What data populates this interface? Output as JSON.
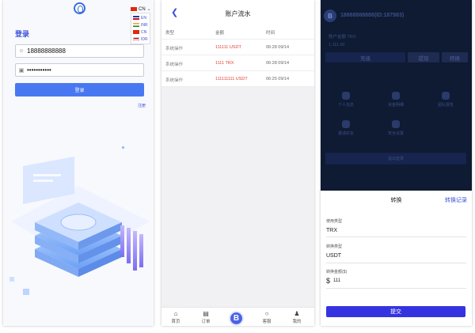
{
  "login": {
    "current_language": "CN",
    "languages": [
      "EN",
      "INR",
      "CN",
      "IDR"
    ],
    "title": "登录",
    "username_value": "18888888888",
    "password_value": "•••••••••••",
    "login_button": "登录",
    "register_link": "注册"
  },
  "flow": {
    "title": "账户流水",
    "columns": [
      "类型",
      "金额",
      "时间"
    ],
    "rows": [
      {
        "type": "系统操作",
        "amount": "111111 USDT",
        "time": "06:28 09/14"
      },
      {
        "type": "系统操作",
        "amount": "1111 TRX",
        "time": "06:28 09/14"
      },
      {
        "type": "系统操作",
        "amount": "111111111 USDT",
        "time": "06:25 09/14"
      }
    ],
    "tabbar": {
      "home": "首页",
      "orders": "订单",
      "center_icon": "B",
      "service": "客服",
      "mine": "我的"
    }
  },
  "convert": {
    "avatar_letter": "B",
    "user_id": "18888888888(ID:187983)",
    "balance_label": "账户金额 TRX",
    "balance_value": "1,111.00",
    "buttons": [
      "充值",
      "提现",
      "转换"
    ],
    "grid": [
      "个人信息",
      "资金明细",
      "团队报告",
      "邀请好友",
      "安全设置"
    ],
    "wide_button": "退出登录",
    "sheet_title": "转换",
    "record_link": "转换记录",
    "fields": [
      {
        "label": "使用类型",
        "value": "TRX"
      },
      {
        "label": "转换类型",
        "value": "USDT"
      },
      {
        "label": "转换金额($)",
        "value": "111"
      }
    ],
    "currency_symbol": "$",
    "submit": "提交"
  },
  "colors": {
    "accent": "#4877f2",
    "link": "#3a4fd8",
    "amount_red": "#e0443a",
    "submit": "#3533e0",
    "overlay": "#0f1a33"
  }
}
